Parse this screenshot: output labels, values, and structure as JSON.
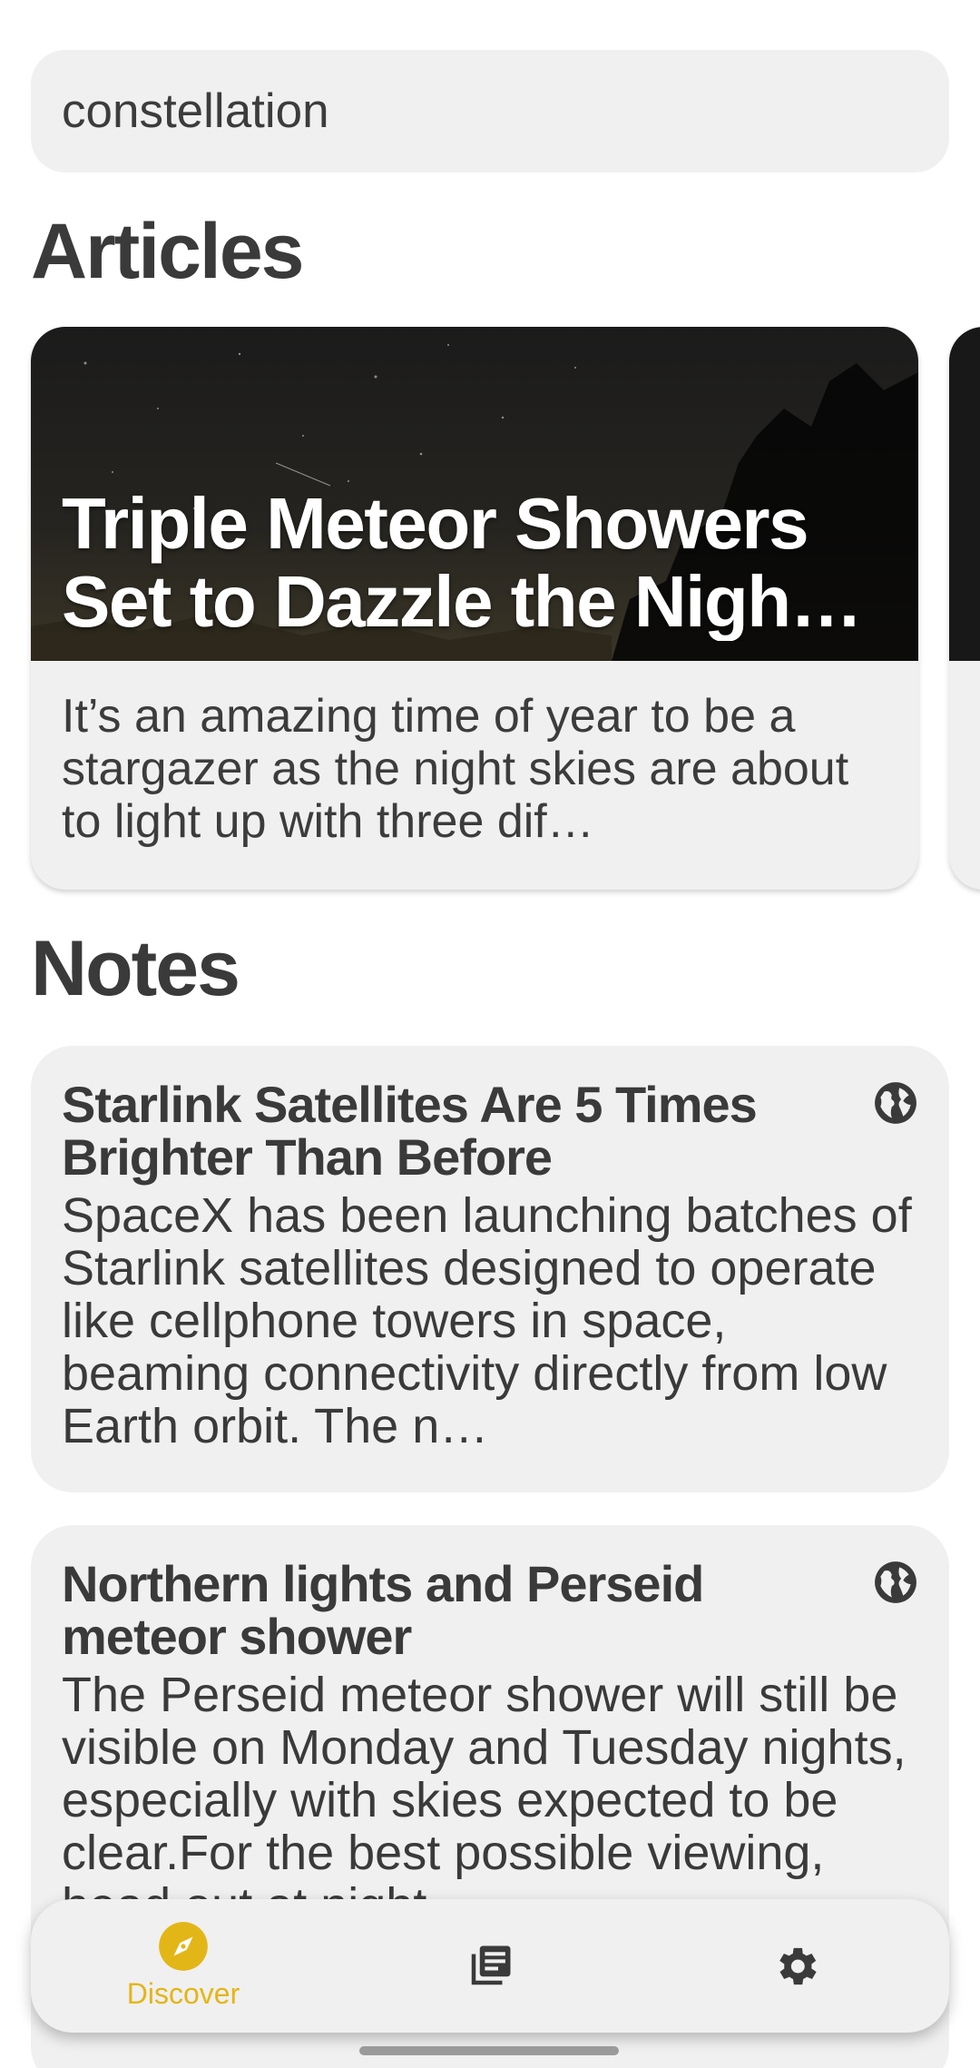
{
  "search": {
    "value": "constellation"
  },
  "sections": {
    "articles_title": "Articles",
    "notes_title": "Notes"
  },
  "articles": [
    {
      "title": "Triple Meteor Showers Set to Dazzle the Nigh…",
      "description": "It’s an amazing time of year to be a stargazer as the night skies are about to light up with three dif…"
    }
  ],
  "notes": [
    {
      "title": "Starlink Satellites Are 5 Times Brighter Than Before",
      "body": "SpaceX has been launching batches of Starlink satellites designed to operate like cellphone towers in space, beaming connectivity directly from low Earth orbit. The n…",
      "icon": "globe-icon"
    },
    {
      "title": "Northern lights and Perseid meteor shower",
      "body": "The Perseid meteor shower will still be visible on Monday and Tuesday nights, especially with skies expected to be clear.For the best possible viewing, head out at night",
      "icon": "globe-icon"
    }
  ],
  "nav": {
    "discover_label": "Discover",
    "accent": "#e3b617",
    "items": [
      "compass-icon",
      "articles-icon",
      "gear-icon"
    ]
  }
}
